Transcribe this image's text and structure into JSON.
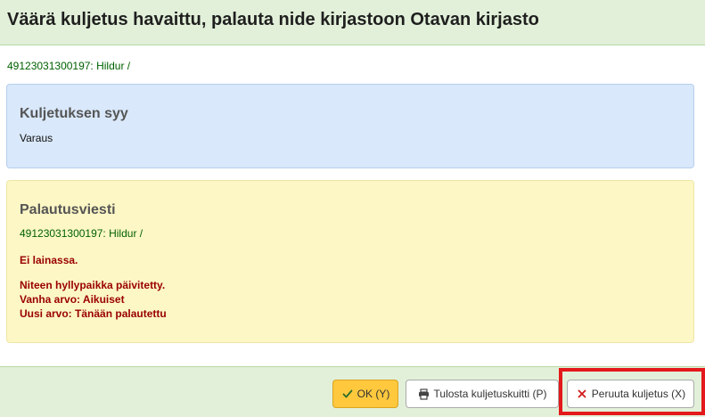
{
  "dialog": {
    "title": "Väärä kuljetus havaittu, palauta nide kirjastoon Otavan kirjasto",
    "item_link": "49123031300197: Hildur /"
  },
  "reason": {
    "heading": "Kuljetuksen syy",
    "value": "Varaus"
  },
  "return_message": {
    "heading": "Palautusviesti",
    "item_link": "49123031300197: Hildur /",
    "not_checked_out": "Ei lainassa.",
    "location_updated": "Niteen hyllypaikka päivitetty.",
    "old_value": "Vanha arvo: Aikuiset",
    "new_value": "Uusi arvo: Tänään palautettu"
  },
  "footer": {
    "ok_label": "OK (Y)",
    "print_label": "Tulosta kuljetuskuitti (P)",
    "cancel_label": "Peruuta kuljetus (X)"
  },
  "icons": {
    "ok": "check-icon",
    "print": "printer-icon",
    "cancel": "close-icon"
  },
  "colors": {
    "header_bg": "#e2f0d9",
    "reason_bg": "#d9e8fa",
    "message_bg": "#fdf7c5",
    "ok_button_bg": "#ffc83d",
    "message_red": "#990000",
    "link_green": "#006100",
    "highlight_red": "#e3191b"
  }
}
